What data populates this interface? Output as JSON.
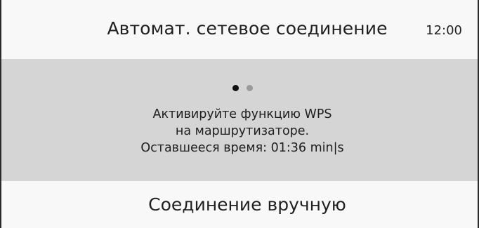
{
  "header": {
    "title": "Автомат. сетевое соединение",
    "time": "12:00"
  },
  "wps_panel": {
    "page_indicator": {
      "active_index": 0,
      "count": 2
    },
    "instruction_line1": "Активируйте функцию WPS",
    "instruction_line2": "на маршрутизаторе.",
    "remaining_time_text": "Оставшееся время:  01:36 min|s"
  },
  "menu": {
    "manual_connection_label": "Соединение вручную"
  },
  "colors": {
    "header_bg": "#f8f8f8",
    "panel_bg": "#d5d5d5",
    "dot_active": "#111111",
    "dot_inactive": "#9a9a9a"
  }
}
